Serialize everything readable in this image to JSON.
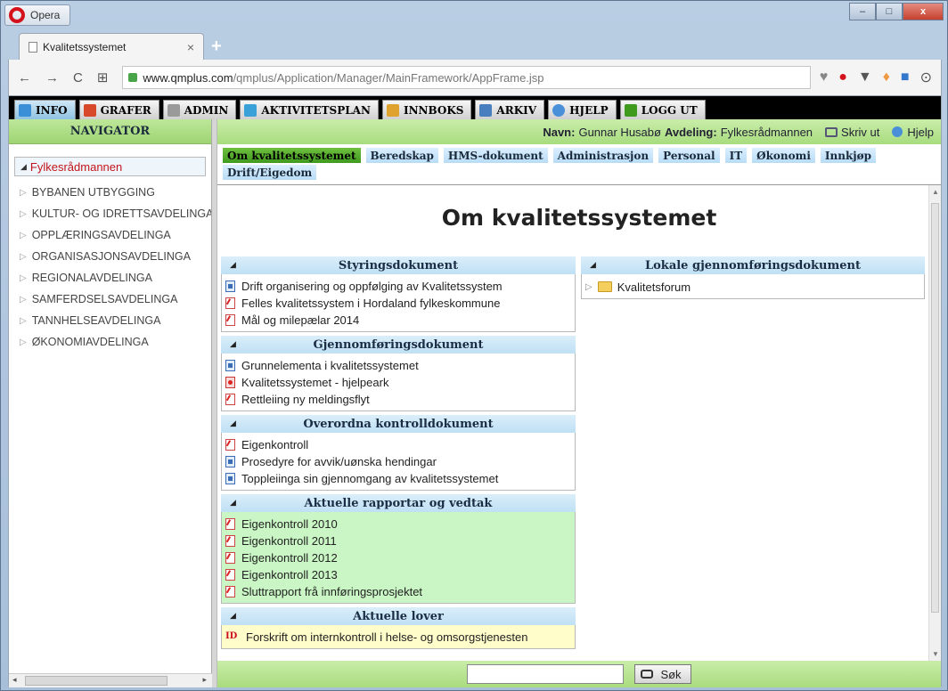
{
  "browser": {
    "name": "Opera",
    "tab_title": "Kvalitetssystemet",
    "tab_close": "×",
    "new_tab": "+",
    "url_host": "www.qmplus.com",
    "url_path": "/qmplus/Application/Manager/MainFramework/AppFrame.jsp",
    "window_controls": [
      "–",
      "□",
      "x"
    ]
  },
  "menu": [
    {
      "label": "INFO",
      "color": "#3a8fd6"
    },
    {
      "label": "GRAFER",
      "color": "#d8482b"
    },
    {
      "label": "ADMIN",
      "color": "#9a9a9a"
    },
    {
      "label": "AKTIVITETSPLAN",
      "color": "#3aa0d8"
    },
    {
      "label": "INNBOKS",
      "color": "#e0a22e"
    },
    {
      "label": "ARKIV",
      "color": "#4a7fbf"
    },
    {
      "label": "HJELP",
      "color": "#4a90d9"
    },
    {
      "label": "LOGG UT",
      "color": "#3f9a1e"
    }
  ],
  "navigator": {
    "title": "NAVIGATOR",
    "root": "Fylkesrådmannen",
    "items": [
      "BYBANEN UTBYGGING",
      "KULTUR- OG IDRETTSAVDELINGA",
      "OPPLÆRINGSAVDELINGA",
      "ORGANISASJONSAVDELINGA",
      "REGIONALAVDELINGA",
      "SAMFERDSELSAVDELINGA",
      "TANNHELSEAVDELINGA",
      "ØKONOMIAVDELINGA"
    ]
  },
  "userbar": {
    "name_label": "Navn:",
    "name_value": "Gunnar Husabø",
    "dept_label": "Avdeling:",
    "dept_value": "Fylkesrådmannen",
    "print": "Skriv ut",
    "help": "Hjelp"
  },
  "subtabs": [
    "Om kvalitetssystemet",
    "Beredskap",
    "HMS-dokument",
    "Administrasjon",
    "Personal",
    "IT",
    "Økonomi",
    "Innkjøp",
    "Drift/Eigedom"
  ],
  "page_title": "Om kvalitetssystemet",
  "sections_left": [
    {
      "title": "Styringsdokument",
      "bg": "white",
      "docs": [
        {
          "type": "word",
          "label": "Drift organisering og oppfølging av Kvalitetssystem"
        },
        {
          "type": "pdf",
          "label": "Felles kvalitetssystem i Hordaland fylkeskommune"
        },
        {
          "type": "pdf",
          "label": "Mål og milepælar 2014"
        }
      ]
    },
    {
      "title": "Gjennomføringsdokument",
      "bg": "white",
      "docs": [
        {
          "type": "word",
          "label": "Grunnelementa i kvalitetssystemet"
        },
        {
          "type": "red",
          "label": "Kvalitetssystemet - hjelpeark"
        },
        {
          "type": "pdf",
          "label": "Rettleiing ny meldingsflyt"
        }
      ]
    },
    {
      "title": "Overordna kontrolldokument",
      "bg": "white",
      "docs": [
        {
          "type": "pdf",
          "label": "Eigenkontroll"
        },
        {
          "type": "word",
          "label": "Prosedyre for avvik/uønska hendingar"
        },
        {
          "type": "word",
          "label": "Toppleiinga sin gjennomgang av kvalitetssystemet"
        }
      ]
    },
    {
      "title": "Aktuelle rapportar og vedtak",
      "bg": "green",
      "docs": [
        {
          "type": "pdf",
          "label": "Eigenkontroll 2010"
        },
        {
          "type": "pdf",
          "label": "Eigenkontroll 2011"
        },
        {
          "type": "pdf",
          "label": "Eigenkontroll 2012"
        },
        {
          "type": "pdf",
          "label": "Eigenkontroll 2013"
        },
        {
          "type": "pdf",
          "label": "Sluttrapport frå innføringsprosjektet"
        }
      ]
    },
    {
      "title": "Aktuelle lover",
      "bg": "yellow",
      "docs": [
        {
          "type": "law",
          "label": "Forskrift om internkontroll i helse- og omsorgstjenesten"
        }
      ]
    }
  ],
  "sections_right": [
    {
      "title": "Lokale gjennomføringsdokument",
      "folders": [
        "Kvalitetsforum"
      ]
    }
  ],
  "search": {
    "value": "",
    "button": "Søk"
  }
}
